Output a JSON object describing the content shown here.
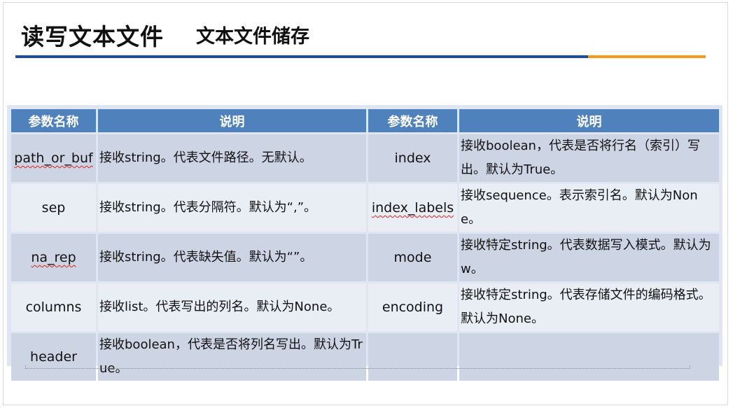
{
  "header": {
    "title": "读写文本文件",
    "subtitle": "文本文件储存"
  },
  "table": {
    "headers": [
      "参数名称",
      "说明",
      "参数名称",
      "说明"
    ],
    "rows": [
      {
        "name1": "path_or_buf",
        "desc1": "接收string。代表文件路径。无默认。",
        "name2": "index",
        "desc2": "接收boolean，代表是否将行名（索引）写出。默认为True。"
      },
      {
        "name1": "sep",
        "desc1": "接收string。代表分隔符。默认为“,”。",
        "name2": "index_labels",
        "desc2": "接收sequence。表示索引名。默认为None。"
      },
      {
        "name1": "na_rep",
        "desc1": "接收string。代表缺失值。默认为“”。",
        "name2": "mode",
        "desc2": "接收特定string。代表数据写入模式。默认为w。"
      },
      {
        "name1": "columns",
        "desc1": "接收list。代表写出的列名。默认为None。",
        "name2": "encoding",
        "desc2": "接收特定string。代表存储文件的编码格式。默认为None。"
      },
      {
        "name1": "header",
        "desc1": "接收boolean，代表是否将列名写出。默认为True。",
        "name2": "",
        "desc2": ""
      }
    ]
  },
  "colors": {
    "header_fill": "#4f81bd",
    "cell_fill": "#cdd5e5",
    "rule_blue": "#1f4ea1",
    "rule_orange": "#f39a1c"
  }
}
